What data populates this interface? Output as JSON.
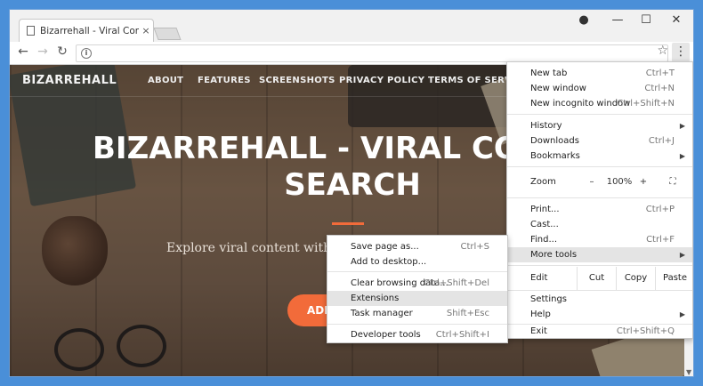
{
  "browser": {
    "tab_title": "Bizarrehall - Viral Conte",
    "tab_close": "×",
    "window_controls": {
      "minimize": "—",
      "maximize": "☐",
      "close": "✕"
    },
    "profile_icon": "●"
  },
  "site": {
    "brand": "BIZARREHALL",
    "nav": [
      "ABOUT",
      "FEATURES",
      "SCREENSHOTS",
      "PRIVACY POLICY",
      "TERMS OF SERVICE"
    ],
    "hero_line1": "BIZARREHALL - VIRAL CON",
    "hero_line2": "SEARCH",
    "subtitle": "Explore viral content with o",
    "cta": "ADD"
  },
  "chrome_menu": {
    "new_tab": {
      "label": "New tab",
      "shortcut": "Ctrl+T"
    },
    "new_window": {
      "label": "New window",
      "shortcut": "Ctrl+N"
    },
    "incognito": {
      "label": "New incognito window",
      "shortcut": "Ctrl+Shift+N"
    },
    "history": {
      "label": "History"
    },
    "downloads": {
      "label": "Downloads",
      "shortcut": "Ctrl+J"
    },
    "bookmarks": {
      "label": "Bookmarks"
    },
    "zoom": {
      "label": "Zoom",
      "minus": "–",
      "value": "100%",
      "plus": "+",
      "fullscreen": "⛶"
    },
    "print": {
      "label": "Print...",
      "shortcut": "Ctrl+P"
    },
    "cast": {
      "label": "Cast..."
    },
    "find": {
      "label": "Find...",
      "shortcut": "Ctrl+F"
    },
    "more_tools": {
      "label": "More tools"
    },
    "edit": {
      "label": "Edit",
      "cut": "Cut",
      "copy": "Copy",
      "paste": "Paste"
    },
    "settings": {
      "label": "Settings"
    },
    "help": {
      "label": "Help"
    },
    "exit": {
      "label": "Exit",
      "shortcut": "Ctrl+Shift+Q"
    }
  },
  "more_tools_menu": {
    "save_page": {
      "label": "Save page as...",
      "shortcut": "Ctrl+S"
    },
    "add_desktop": {
      "label": "Add to desktop..."
    },
    "clear_data": {
      "label": "Clear browsing data...",
      "shortcut": "Ctrl+Shift+Del"
    },
    "extensions": {
      "label": "Extensions"
    },
    "task_manager": {
      "label": "Task manager",
      "shortcut": "Shift+Esc"
    },
    "dev_tools": {
      "label": "Developer tools",
      "shortcut": "Ctrl+Shift+I"
    }
  }
}
